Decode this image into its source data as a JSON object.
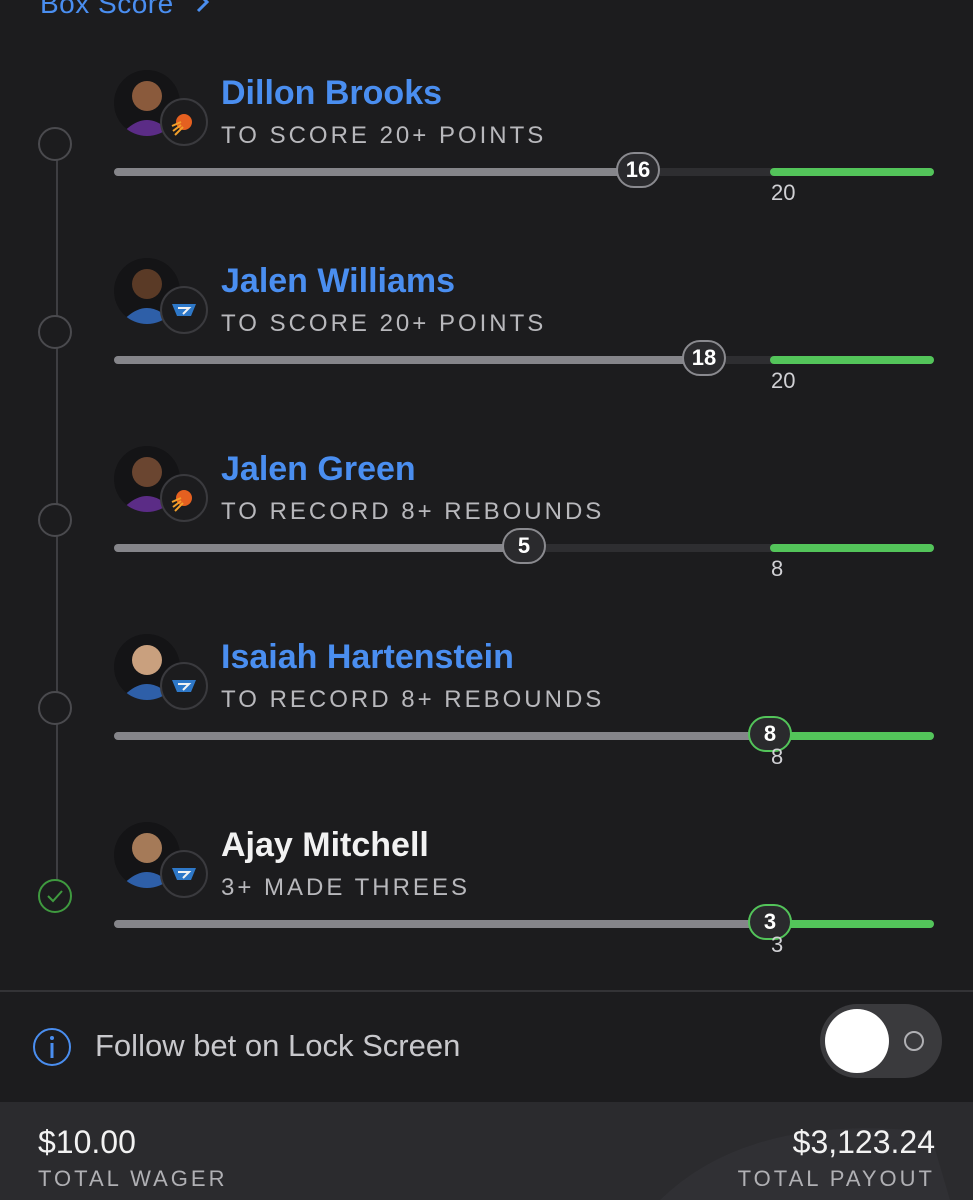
{
  "header": {
    "box_score_link": "Box Score",
    "chevron_icon": "chevron-right-icon"
  },
  "legs": [
    {
      "player": "Dillon Brooks",
      "market": "TO SCORE 20+ POINTS",
      "current": "16",
      "target": "20",
      "progress_fraction": 0.8,
      "team_icon": "suns-logo-icon",
      "status": "open",
      "hit": false
    },
    {
      "player": "Jalen Williams",
      "market": "TO SCORE 20+ POINTS",
      "current": "18",
      "target": "20",
      "progress_fraction": 0.9,
      "team_icon": "thunder-logo-icon",
      "status": "open",
      "hit": false
    },
    {
      "player": "Jalen Green",
      "market": "TO RECORD 8+ REBOUNDS",
      "current": "5",
      "target": "8",
      "progress_fraction": 0.625,
      "team_icon": "suns-logo-icon",
      "status": "open",
      "hit": false
    },
    {
      "player": "Isaiah Hartenstein",
      "market": "TO RECORD 8+ REBOUNDS",
      "current": "8",
      "target": "8",
      "progress_fraction": 1.0,
      "team_icon": "thunder-logo-icon",
      "status": "open",
      "hit": true
    },
    {
      "player": "Ajay Mitchell",
      "market": "3+ MADE THREES",
      "current": "3",
      "target": "3",
      "progress_fraction": 1.0,
      "team_icon": "thunder-logo-icon",
      "status": "won",
      "hit": true
    }
  ],
  "follow": {
    "label": "Follow bet on Lock Screen",
    "toggle_on": false,
    "info_icon": "info-icon"
  },
  "footer": {
    "total_wager_amount": "$10.00",
    "total_wager_label": "TOTAL WAGER",
    "total_payout_amount": "$3,123.24",
    "total_payout_label": "TOTAL PAYOUT"
  },
  "colors": {
    "background": "#1c1c1e",
    "link_blue": "#4a8ef0",
    "goal_green": "#53c45a",
    "progress_gray": "#85858a",
    "footer_bg": "#2b2b2e"
  }
}
